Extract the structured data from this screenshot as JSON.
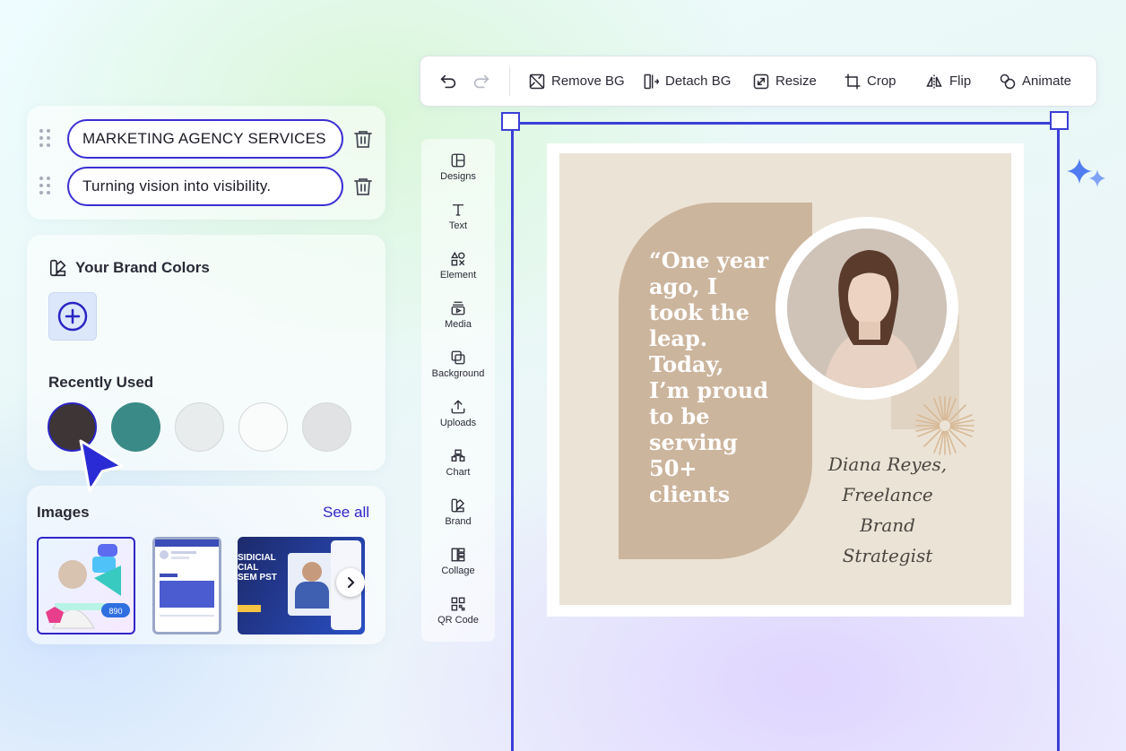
{
  "text_layers": [
    {
      "value": "MARKETING AGENCY SERVICES"
    },
    {
      "value": "Turning vision into visibility."
    }
  ],
  "brand_colors": {
    "title": "Your Brand Colors",
    "add_icon": "plus-circle-icon",
    "recently_used_title": "Recently Used",
    "recent": [
      "#3d3536",
      "#3a8a87",
      "#e8ecec",
      "#fafbfb",
      "#e1e2e4"
    ]
  },
  "images": {
    "title": "Images",
    "see_all": "See all",
    "thumb3_text": "SIDICIAL\nCIAL\nSEM PST",
    "thumb1_badge": "890"
  },
  "toolbar": {
    "undo_icon": "undo-icon",
    "redo_icon": "redo-icon",
    "remove_bg": "Remove BG",
    "detach_bg": "Detach BG",
    "resize": "Resize",
    "crop": "Crop",
    "flip": "Flip",
    "animate": "Animate"
  },
  "rail": [
    {
      "label": "Designs",
      "icon": "layout-icon"
    },
    {
      "label": "Text",
      "icon": "text-icon"
    },
    {
      "label": "Element",
      "icon": "shapes-icon"
    },
    {
      "label": "Media",
      "icon": "media-icon"
    },
    {
      "label": "Background",
      "icon": "background-icon"
    },
    {
      "label": "Uploads",
      "icon": "upload-icon"
    },
    {
      "label": "Chart",
      "icon": "chart-icon"
    },
    {
      "label": "Brand",
      "icon": "brand-icon"
    },
    {
      "label": "Collage",
      "icon": "collage-icon"
    },
    {
      "label": "QR Code",
      "icon": "qr-code-icon"
    }
  ],
  "design": {
    "quote": "“One year\nago, I\ntook the\nleap.\nToday,\nI’m proud\nto be\nserving\n50+\nclients",
    "signature": "Diana Reyes,\nFreelance Brand\nStrategist",
    "colors": {
      "background": "#ebe3d6",
      "shape": "#ccb59d",
      "accent": "#3b3fd6"
    }
  }
}
